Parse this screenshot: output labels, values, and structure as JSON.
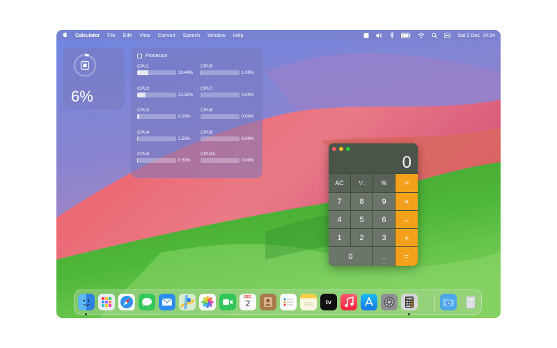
{
  "menubar": {
    "apple_icon": "apple-icon",
    "app_name": "Calculator",
    "menus": [
      "File",
      "Edit",
      "View",
      "Convert",
      "Speech",
      "Window",
      "Help"
    ],
    "status_icons": [
      "stats-icon",
      "volume-icon",
      "bluetooth-icon",
      "battery-icon",
      "wifi-icon",
      "search-icon",
      "control-center-icon"
    ],
    "datetime": "Sat 2 Dec  14:34"
  },
  "cpu_widget": {
    "total": "6%",
    "level": 0.06,
    "icon": "cpu-chip-icon"
  },
  "processor_widget": {
    "title": "Processor",
    "cores": [
      {
        "name": "CPU1",
        "value": "29.44%",
        "level": 0.2944
      },
      {
        "name": "CPU2",
        "value": "21.32%",
        "level": 0.2132
      },
      {
        "name": "CPU3",
        "value": "6.00%",
        "level": 0.06
      },
      {
        "name": "CPU4",
        "value": "2.50%",
        "level": 0.025
      },
      {
        "name": "CPU5",
        "value": "0.50%",
        "level": 0.005
      },
      {
        "name": "CPU6",
        "value": "1.00%",
        "level": 0.01
      },
      {
        "name": "CPU7",
        "value": "0.00%",
        "level": 0
      },
      {
        "name": "CPU8",
        "value": "0.00%",
        "level": 0
      },
      {
        "name": "CPU9",
        "value": "0.00%",
        "level": 0
      },
      {
        "name": "CPU10",
        "value": "0.00%",
        "level": 0
      }
    ]
  },
  "calculator": {
    "display": "0",
    "keys": {
      "ac": "AC",
      "sign": "⁺∕₋",
      "percent": "%",
      "divide": "÷",
      "k7": "7",
      "k8": "8",
      "k9": "9",
      "multiply": "×",
      "k4": "4",
      "k5": "5",
      "k6": "6",
      "minus": "–",
      "k1": "1",
      "k2": "2",
      "k3": "3",
      "plus": "+",
      "k0": "0",
      "decimal": ",",
      "equals": "="
    },
    "accent_color": "#f3a11a"
  },
  "dock": {
    "apps": [
      "finder",
      "launchpad",
      "safari",
      "messages",
      "mail",
      "maps",
      "photos",
      "facetime",
      "calendar",
      "contacts",
      "reminders",
      "notes",
      "tv",
      "music",
      "app-store",
      "system-settings",
      "calculator",
      "downloads",
      "trash"
    ],
    "calendar_month": "DEC",
    "calendar_day": "2",
    "tv_label": "tv"
  }
}
